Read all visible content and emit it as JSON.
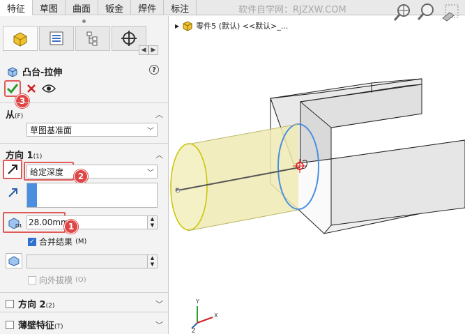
{
  "tabs": [
    "特征",
    "草图",
    "曲面",
    "钣金",
    "焊件",
    "标注"
  ],
  "active_tab_index": 0,
  "watermark": "软件自学网：RJZXW.COM",
  "feature_tree": {
    "part_label": "零件5 (默认) <<默认>_..."
  },
  "property_manager": {
    "title": "凸台-拉伸",
    "help_symbol": "?",
    "from": {
      "header": "从",
      "shortcut": "(F)",
      "value": "草图基准面"
    },
    "direction1": {
      "header": "方向 1",
      "shortcut": "(1)",
      "end_condition": "给定深度",
      "depth_value": "28.00mm",
      "merge_label": "合并结果",
      "merge_shortcut": "(M)",
      "merge_checked": true,
      "draft_label": "向外拔模",
      "draft_shortcut": "(O)",
      "draft_checked": false
    },
    "direction2": {
      "header": "方向 2",
      "shortcut": "(2)",
      "checked": false
    },
    "thin_feature": {
      "header": "薄壁特征",
      "shortcut": "(T)",
      "checked": false
    }
  },
  "badges": {
    "confirm": "3",
    "end_condition": "2",
    "depth": "1"
  },
  "triad": {
    "x": "X",
    "y": "Y",
    "z": "Z"
  },
  "colors": {
    "badge_red": "#e04545",
    "highlight_red": "#e05a5a",
    "extrude_preview": "#eeeab3",
    "selection_blue": "#4a8fe0"
  }
}
